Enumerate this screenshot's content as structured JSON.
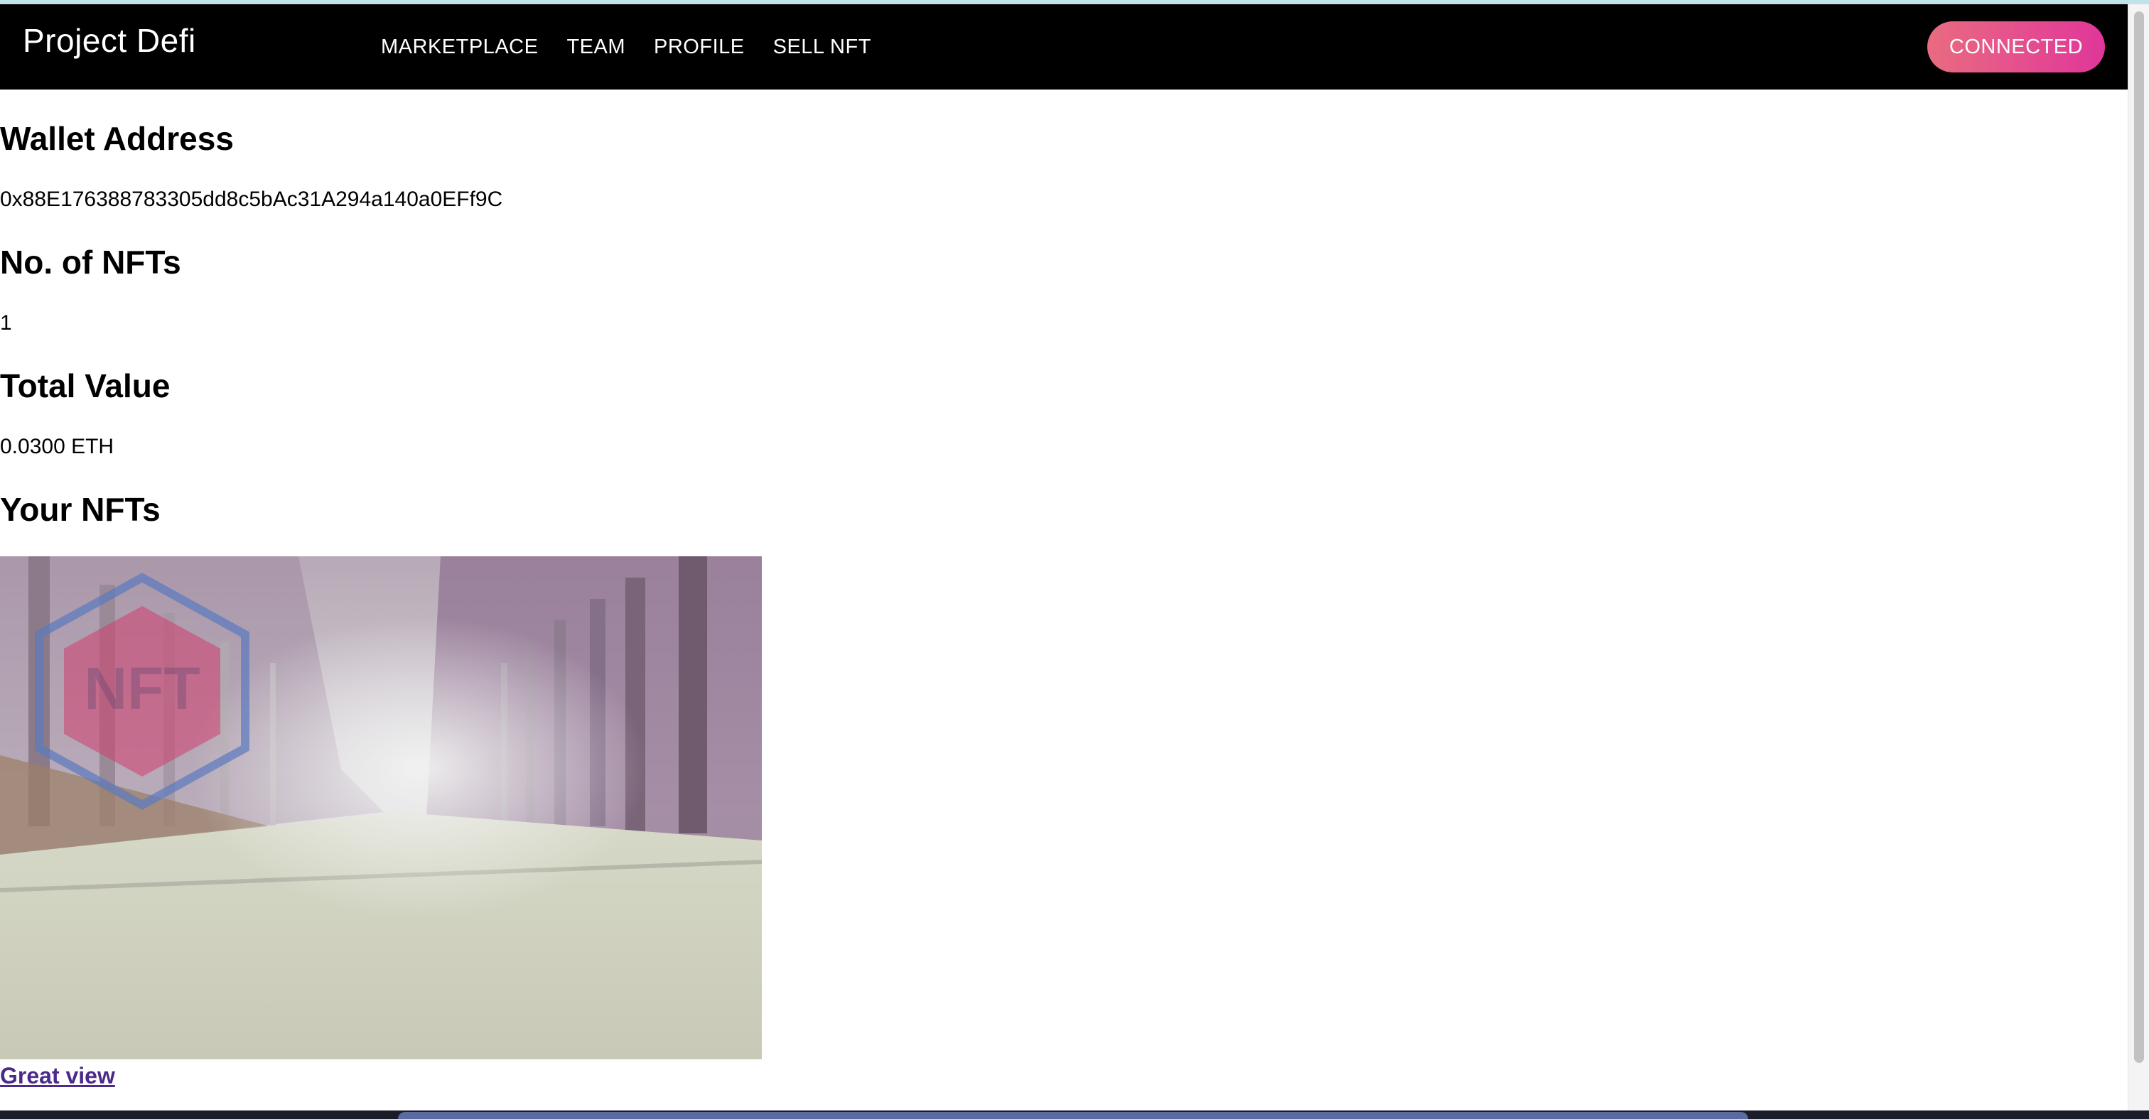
{
  "navbar": {
    "brand": "Project Defi",
    "links": [
      {
        "label": "MARKETPLACE"
      },
      {
        "label": "TEAM"
      },
      {
        "label": "PROFILE"
      },
      {
        "label": "SELL NFT"
      }
    ],
    "connect_button": "CONNECTED"
  },
  "profile": {
    "wallet_title": "Wallet Address",
    "wallet_address": "0x88E176388783305dd8c5bAc31A294a140a0EFf9C",
    "nft_count_title": "No. of NFTs",
    "nft_count": "1",
    "total_value_title": "Total Value",
    "total_value": "0.0300 ETH",
    "your_nfts_title": "Your NFTs"
  },
  "nfts": [
    {
      "title": "Great view",
      "image": "misty-tree-lined-road-photo",
      "watermark": "NFT"
    }
  ],
  "colors": {
    "navbar_bg": "#000000",
    "button_gradient_start": "#e96b80",
    "button_gradient_end": "#e0369a",
    "link_visited": "#4b2a8a"
  }
}
